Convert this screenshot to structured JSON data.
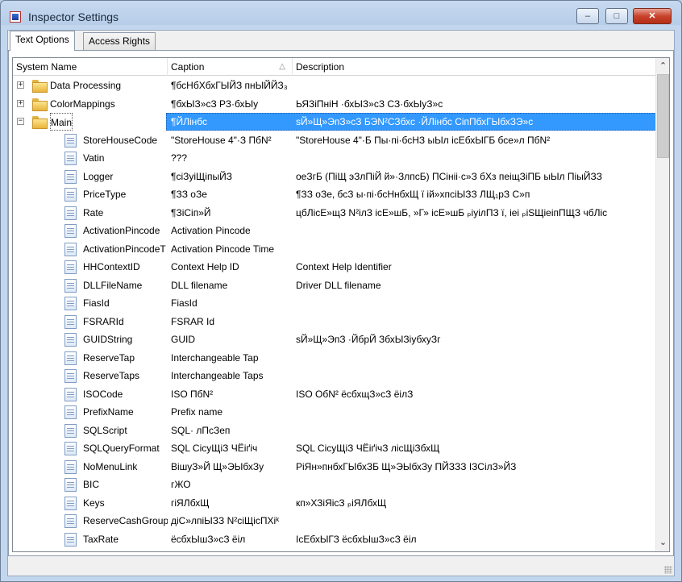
{
  "window": {
    "title": "Inspector Settings",
    "min": "–",
    "max": "□",
    "close": "✕"
  },
  "tabs": [
    {
      "label": "Text Options",
      "active": true
    },
    {
      "label": "Access Rights",
      "active": false
    }
  ],
  "columns": {
    "name": "System Name",
    "caption": "Caption",
    "description": "Description",
    "sort_indicator": "△"
  },
  "rows": [
    {
      "type": "folder",
      "state": "collapsed",
      "name": "Data Processing",
      "caption": "¶бсНбХбхГЫЙЗ пнЫЙЙЗ₃",
      "description": ""
    },
    {
      "type": "folder",
      "state": "collapsed",
      "name": "ColorMappings",
      "caption": "¶бхЫЗ»сЗ РЗ·бхЫу",
      "description": "ЬЯЗіПніН ·бхЫЗ»сЗ СЗ·бхЫуЗ»с"
    },
    {
      "type": "folder",
      "state": "expanded",
      "name": "Main",
      "caption": "¶ЙЛінбс",
      "description": "sЙ»Щ»ЭпЗ»сЗ БЭN²СЗбхс ·ЙЛінбс СіпПбхГЫбхЗЭ»с",
      "selected": true
    },
    {
      "type": "item",
      "name": "StoreHouseCode",
      "caption": "\"StoreHouse 4\"·З ПбN²",
      "description": "\"StoreHouse 4\"·Б Пы·пі·бсНЗ ыЫл ісЕбхЫГБ бсе»л ПбN²"
    },
    {
      "type": "item",
      "name": "Vatin",
      "caption": "???",
      "description": ""
    },
    {
      "type": "item",
      "name": "Logger",
      "caption": "¶сіЗуіЩіпыЙЗ",
      "description": "оеЗгБ (ПіЩ эЗлПіЙ й»·ЗлпсБ) ПСініі·с»З бХз пеіщЗіПБ ыЫл ПіыЙЗЗ"
    },
    {
      "type": "item",
      "name": "PriceType",
      "caption": "¶ЗЗ оЗе",
      "description": "¶ЗЗ оЗе, бсЗ ы·пі·бсНнбхЩ ї ій»хпсіЫЗЗ ЛЩ₁рЗ С»п"
    },
    {
      "type": "item",
      "name": "Rate",
      "caption": "¶ЗіСіп»Й",
      "description": "цбЛісЕ»щЗ N²ілЗ ісЕ»шБ, »Г» ісЕ»шБ ₚіуілПЗ ї, іеі ₚіЅЩіеіпПЩЗ чбЛіс"
    },
    {
      "type": "item",
      "name": "ActivationPincode",
      "caption": "Activation Pincode",
      "description": ""
    },
    {
      "type": "item",
      "name": "ActivationPincodeT",
      "caption": "Activation Pincode Time",
      "description": ""
    },
    {
      "type": "item",
      "name": "HHContextID",
      "caption": "Context Help ID",
      "description": "Context Help Identifier"
    },
    {
      "type": "item",
      "name": "DLLFileName",
      "caption": "DLL filename",
      "description": "Driver DLL filename"
    },
    {
      "type": "item",
      "name": "FiasId",
      "caption": "FiasId",
      "description": ""
    },
    {
      "type": "item",
      "name": "FSRARId",
      "caption": "FSRAR Id",
      "description": ""
    },
    {
      "type": "item",
      "name": "GUIDString",
      "caption": "GUID",
      "description": "sЙ»Щ»ЭпЗ ·ЙбрЙ ЗбхЫЗіубхуЗг"
    },
    {
      "type": "item",
      "name": "ReserveTap",
      "caption": "Interchangeable Tap",
      "description": ""
    },
    {
      "type": "item",
      "name": "ReserveTaps",
      "caption": "Interchangeable Taps",
      "description": ""
    },
    {
      "type": "item",
      "name": "ISOCode",
      "caption": "ISO ПбN²",
      "description": "ISO ОбN² ёсбхщЗ»сЗ ёілЗ"
    },
    {
      "type": "item",
      "name": "PrefixName",
      "caption": "Prefix name",
      "description": ""
    },
    {
      "type": "item",
      "name": "SQLScript",
      "caption": "SQL· лПсЗеп",
      "description": ""
    },
    {
      "type": "item",
      "name": "SQLQueryFormat",
      "caption": "SQL СісуЩіЗ ЧЁіґіч",
      "description": "SQL СісуЩіЗ ЧЁіґічЗ лісЩіЗбхЩ"
    },
    {
      "type": "item",
      "name": "NoMenuLink",
      "caption": "ВішуЗ»Й Щ»ЭЫбхЗу",
      "description": "РіЯн»пнбхГЫбхЗБ Щ»ЭЫбхЗу ПЙЗЗЗ ІЗСілЗ»ЙЗ"
    },
    {
      "type": "item",
      "name": "BIC",
      "caption": "гЖО",
      "description": ""
    },
    {
      "type": "item",
      "name": "Keys",
      "caption": "гіЯЛбхЩ",
      "description": "кп»ХЗіЯісЗ ₚіЯЛбхЩ"
    },
    {
      "type": "item",
      "name": "ReserveCashGroup",
      "caption": "діС»лпіЫЗЗ N²сіЩісПХіᵏ",
      "description": ""
    },
    {
      "type": "item",
      "name": "TaxRate",
      "caption": "ёсбхЫшЗ»сЗ ёіл",
      "description": "ІсЕбхЫГЗ ёсбхЫшЗ»сЗ ёіл"
    }
  ]
}
